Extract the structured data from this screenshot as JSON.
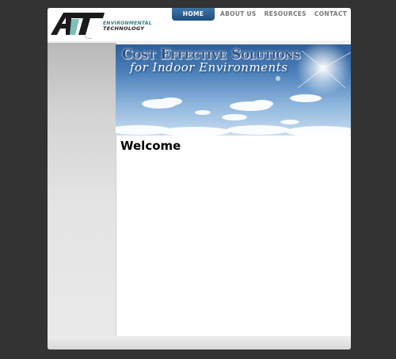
{
  "logo": {
    "mark": "AT",
    "line1": "ENVIRONMENTAL",
    "line2": "TECHNOLOGY"
  },
  "nav": {
    "items": [
      {
        "label": "HOME",
        "active": true
      },
      {
        "label": "ABOUT US",
        "active": false
      },
      {
        "label": "RESOURCES",
        "active": false
      },
      {
        "label": "CONTACT",
        "active": false
      }
    ]
  },
  "banner": {
    "title": "Cost Effective Solutions",
    "subtitle": "for Indoor Environments"
  },
  "main": {
    "heading": "Welcome"
  },
  "colors": {
    "background": "#333333",
    "nav_active": "#2a5b8f",
    "logo_accent": "#7fbfb9"
  }
}
